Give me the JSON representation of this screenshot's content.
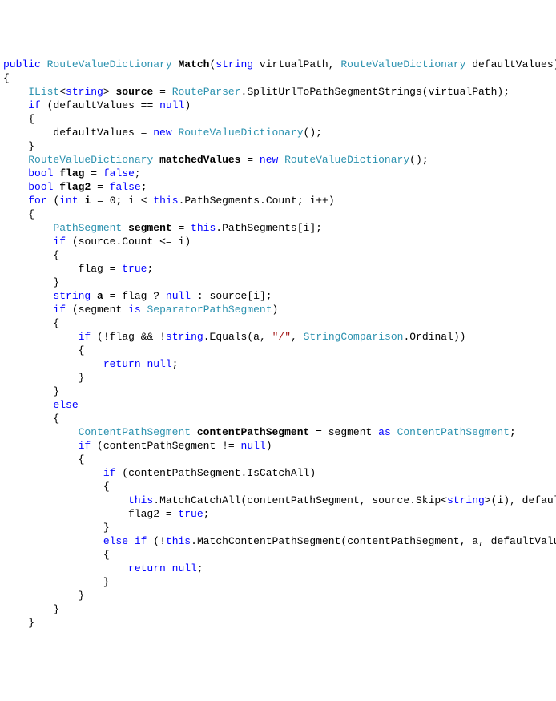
{
  "keywords": {
    "public": "public",
    "string": "string",
    "if": "if",
    "null": "null",
    "new": "new",
    "bool": "bool",
    "false": "false",
    "true": "true",
    "for": "for",
    "int": "int",
    "this": "this",
    "is": "is",
    "return": "return",
    "else": "else",
    "as": "as"
  },
  "types": {
    "RouteValueDictionary": "RouteValueDictionary",
    "IList": "IList",
    "RouteParser": "RouteParser",
    "PathSegment": "PathSegment",
    "SeparatorPathSegment": "SeparatorPathSegment",
    "StringComparison": "StringComparison",
    "ContentPathSegment": "ContentPathSegment"
  },
  "names": {
    "Match": "Match",
    "virtualPath": "virtualPath",
    "defaultValues": "defaultValues",
    "source": "source",
    "SplitUrlToPathSegmentStrings": "SplitUrlToPathSegmentStrings",
    "matchedValues": "matchedValues",
    "flag": "flag",
    "flag2": "flag2",
    "i": "i",
    "PathSegments": "PathSegments",
    "Count": "Count",
    "segment": "segment",
    "a": "a",
    "Equals": "Equals",
    "Ordinal": "Ordinal",
    "contentPathSegment": "contentPathSegment",
    "IsCatchAll": "IsCatchAll",
    "MatchCatchAll": "MatchCatchAll",
    "Skip": "Skip",
    "MatchContentPathSegment": "MatchContentPathSegment"
  },
  "strings": {
    "slash": "\"/\""
  },
  "punct": {
    "lt": "<",
    "gt": ">",
    "lparen": "(",
    "rparen": ")",
    "lbrace": "{",
    "rbrace": "}",
    "comma": ", ",
    "semi": ";",
    "space": " ",
    "eq": " = ",
    "eqeq": " == ",
    "neq": " != ",
    "lte": " <= ",
    "dot": ".",
    "lbracket": "[",
    "rbracket": "]",
    "plusplus": "++",
    "ternq": " ? ",
    "terne": " : ",
    "not": "!",
    "andand": " && "
  },
  "indent": {
    "i0": "",
    "i1": "    ",
    "i2": "        ",
    "i3": "            ",
    "i4": "                ",
    "i5": "                    ",
    "i6": "                        "
  }
}
